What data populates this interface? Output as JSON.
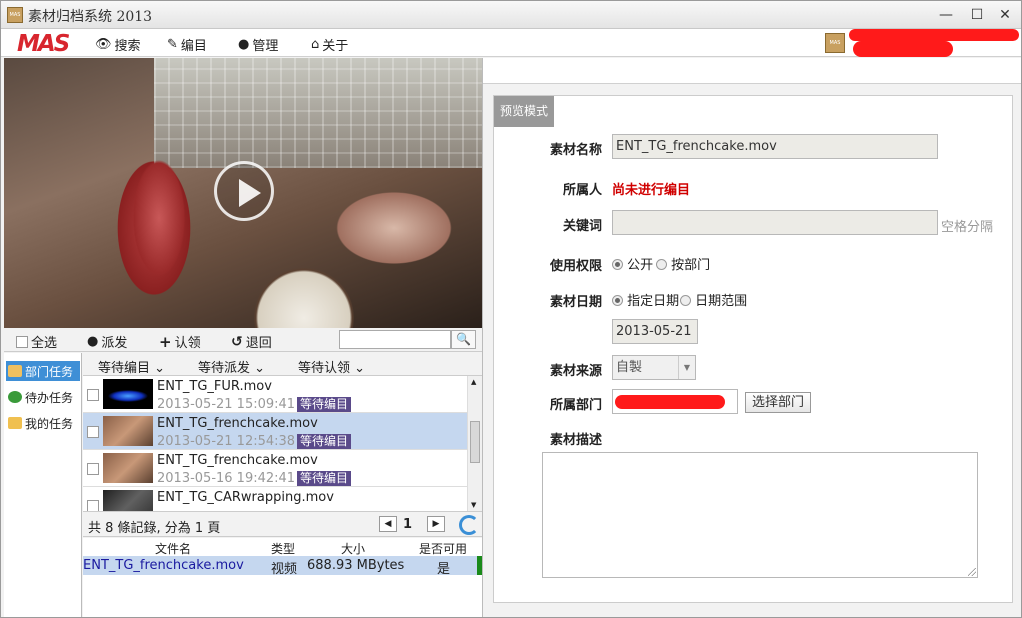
{
  "window": {
    "title": "素材归档系统 2013",
    "app_icon_label": "MAS"
  },
  "menubar": {
    "logo": "MAS",
    "items": [
      {
        "label": "搜索",
        "icon": "eye-icon"
      },
      {
        "label": "编目",
        "icon": "pencil-icon"
      },
      {
        "label": "管理",
        "icon": "user-icon"
      },
      {
        "label": "关于",
        "icon": "home-icon"
      }
    ],
    "user_icon_label": "MAS"
  },
  "toolbar": {
    "select_all": "全选",
    "dispatch": "派发",
    "claim": "认领",
    "return": "退回",
    "search_placeholder": ""
  },
  "sidenav": {
    "items": [
      {
        "label": "部门任务",
        "selected": true
      },
      {
        "label": "待办任务",
        "selected": false
      },
      {
        "label": "我的任务",
        "selected": false
      }
    ]
  },
  "filters": [
    "等待编目",
    "等待派发",
    "等待认领"
  ],
  "list": [
    {
      "name": "ENT_TG_FUR.mov",
      "date": "2013-05-21 15:09:41",
      "status": "等待编目",
      "selected": false
    },
    {
      "name": "ENT_TG_frenchcake.mov",
      "date": "2013-05-21 12:54:38",
      "status": "等待编目",
      "selected": true
    },
    {
      "name": "ENT_TG_frenchcake.mov",
      "date": "2013-05-16 19:42:41",
      "status": "等待编目",
      "selected": false
    },
    {
      "name": "ENT_TG_CARwrapping.mov",
      "date": "",
      "status": "",
      "selected": false
    }
  ],
  "pager": {
    "info": "共 8 條記錄, 分為 1 頁",
    "page": "1"
  },
  "detail_table": {
    "headers": [
      "文件名",
      "类型",
      "大小",
      "是否可用"
    ],
    "row": {
      "filename": "ENT_TG_frenchcake.mov",
      "type": "视频",
      "size": "688.93 MBytes",
      "available": "是"
    }
  },
  "form": {
    "tab": "预览模式",
    "name_label": "素材名称",
    "name_value": "ENT_TG_frenchcake.mov",
    "owner_label": "所属人",
    "owner_value": "尚未进行编目",
    "keywords_label": "关键词",
    "keywords_value": "",
    "keywords_hint": "空格分隔",
    "permission_label": "使用权限",
    "permission_options": [
      "公开",
      "按部门"
    ],
    "date_label": "素材日期",
    "date_options": [
      "指定日期",
      "日期范围"
    ],
    "date_value": "2013-05-21",
    "source_label": "素材来源",
    "source_value": "自製",
    "dept_label": "所属部门",
    "dept_button": "选择部门",
    "desc_label": "素材描述",
    "desc_value": ""
  },
  "colors": {
    "accent": "#3f8fd6",
    "status_badge": "#5a4a8a",
    "warning_text": "#d00000",
    "logo": "#d8262e"
  }
}
